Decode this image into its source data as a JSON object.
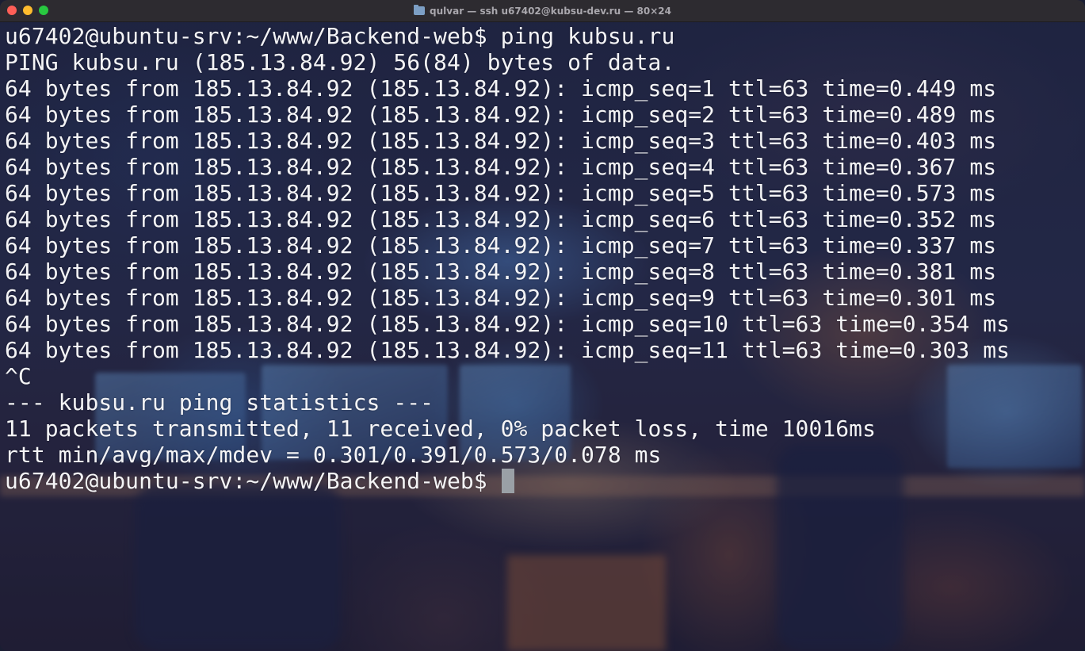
{
  "window": {
    "title": "qulvar — ssh u67402@kubsu-dev.ru — 80×24",
    "title_icon": "folder-icon"
  },
  "terminal": {
    "lines": [
      "u67402@ubuntu-srv:~/www/Backend-web$ ping kubsu.ru",
      "PING kubsu.ru (185.13.84.92) 56(84) bytes of data.",
      "64 bytes from 185.13.84.92 (185.13.84.92): icmp_seq=1 ttl=63 time=0.449 ms",
      "64 bytes from 185.13.84.92 (185.13.84.92): icmp_seq=2 ttl=63 time=0.489 ms",
      "64 bytes from 185.13.84.92 (185.13.84.92): icmp_seq=3 ttl=63 time=0.403 ms",
      "64 bytes from 185.13.84.92 (185.13.84.92): icmp_seq=4 ttl=63 time=0.367 ms",
      "64 bytes from 185.13.84.92 (185.13.84.92): icmp_seq=5 ttl=63 time=0.573 ms",
      "64 bytes from 185.13.84.92 (185.13.84.92): icmp_seq=6 ttl=63 time=0.352 ms",
      "64 bytes from 185.13.84.92 (185.13.84.92): icmp_seq=7 ttl=63 time=0.337 ms",
      "64 bytes from 185.13.84.92 (185.13.84.92): icmp_seq=8 ttl=63 time=0.381 ms",
      "64 bytes from 185.13.84.92 (185.13.84.92): icmp_seq=9 ttl=63 time=0.301 ms",
      "64 bytes from 185.13.84.92 (185.13.84.92): icmp_seq=10 ttl=63 time=0.354 ms",
      "64 bytes from 185.13.84.92 (185.13.84.92): icmp_seq=11 ttl=63 time=0.303 ms",
      "^C",
      "--- kubsu.ru ping statistics ---",
      "11 packets transmitted, 11 received, 0% packet loss, time 10016ms",
      "rtt min/avg/max/mdev = 0.301/0.391/0.573/0.078 ms"
    ],
    "prompt": "u67402@ubuntu-srv:~/www/Backend-web$ "
  },
  "colors": {
    "text": "#f4f4f6",
    "titlebar": "#2d2b30",
    "cursor": "#9aa0a6"
  }
}
